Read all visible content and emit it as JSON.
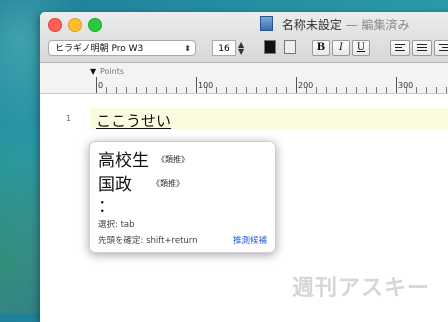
{
  "window": {
    "title": "名称未設定",
    "title_separator": "—",
    "title_status": "編集済み"
  },
  "toolbar": {
    "font_name": "ヒラギノ明朝 Pro W3",
    "font_size": "16",
    "bold_label": "B",
    "italic_label": "I",
    "underline_label": "U"
  },
  "ruler": {
    "units_label": "Points",
    "numbers": [
      "0",
      "100",
      "200",
      "300"
    ]
  },
  "editor": {
    "line_number": "1",
    "input_text": "ここうせい"
  },
  "candidates": {
    "items": [
      {
        "word": "高校生",
        "tag": "《類推》"
      },
      {
        "word": "国政",
        "tag": "《類推》"
      },
      {
        "word": "：",
        "tag": ""
      }
    ],
    "hint_select": "選択: tab",
    "hint_confirm": "先頭を確定: shift+return",
    "more_label": "推測候補"
  },
  "watermark": "週刊アスキー"
}
